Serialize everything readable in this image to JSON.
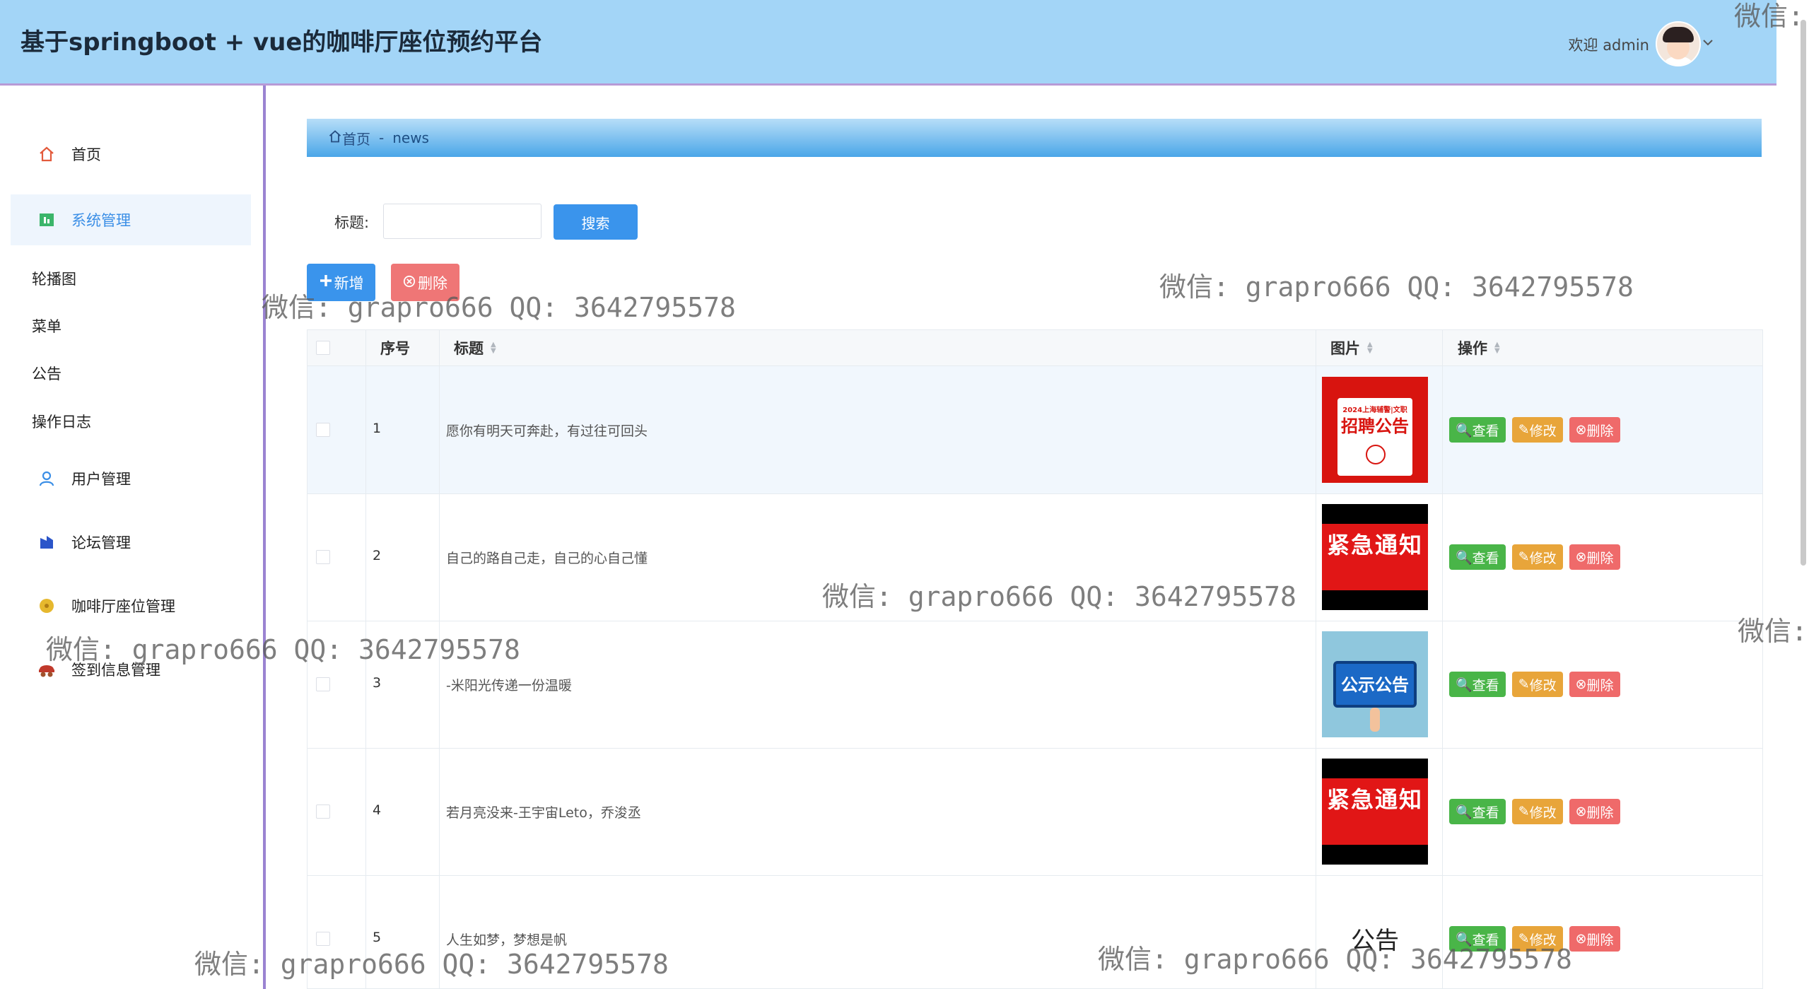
{
  "header": {
    "title": "基于springboot + vue的咖啡厅座位预约平台",
    "welcome": "欢迎 admin"
  },
  "sidebar": {
    "items": [
      {
        "label": "首页",
        "icon": "home-icon"
      },
      {
        "label": "系统管理",
        "icon": "system-icon",
        "active": true
      },
      {
        "label": "用户管理",
        "icon": "user-icon"
      },
      {
        "label": "论坛管理",
        "icon": "forum-icon"
      },
      {
        "label": "咖啡厅座位管理",
        "icon": "coffee-icon"
      },
      {
        "label": "签到信息管理",
        "icon": "checkin-icon"
      }
    ],
    "sub_items": [
      {
        "label": "轮播图"
      },
      {
        "label": "菜单"
      },
      {
        "label": "公告"
      },
      {
        "label": "操作日志"
      }
    ]
  },
  "breadcrumb": {
    "home": "首页",
    "separator": "-",
    "current": "news"
  },
  "search": {
    "label": "标题:",
    "value": "",
    "button": "搜索"
  },
  "actions": {
    "add": "新增",
    "delete": "删除"
  },
  "table": {
    "columns": {
      "index": "序号",
      "title": "标题",
      "image": "图片",
      "ops": "操作"
    },
    "rows": [
      {
        "index": "1",
        "title": "愿你有明天可奔赴，有过往可回头"
      },
      {
        "index": "2",
        "title": "自己的路自己走，自己的心自己懂"
      },
      {
        "index": "3",
        "title": "-米阳光传递一份温暖"
      },
      {
        "index": "4",
        "title": "若月亮没来-王宇宙Leto，乔浚丞"
      },
      {
        "index": "5",
        "title": "人生如梦，梦想是帆"
      }
    ],
    "op_labels": {
      "view": "查看",
      "edit": "修改",
      "delete": "删除"
    },
    "thumbs": {
      "t1_top": "2024上海辅警|文职",
      "t1_main": "招聘公告",
      "urgent": "紧急通知",
      "notice": "公示公告",
      "plain": "公告"
    }
  },
  "watermarks": {
    "full": "微信: grapro666 QQ: 3642795578",
    "partial": "微信:"
  },
  "colors": {
    "header_bg": "#a3d5f7",
    "accent": "#3a94ec",
    "danger": "#ef7676",
    "success": "#49b548",
    "warning": "#e8a53a"
  }
}
